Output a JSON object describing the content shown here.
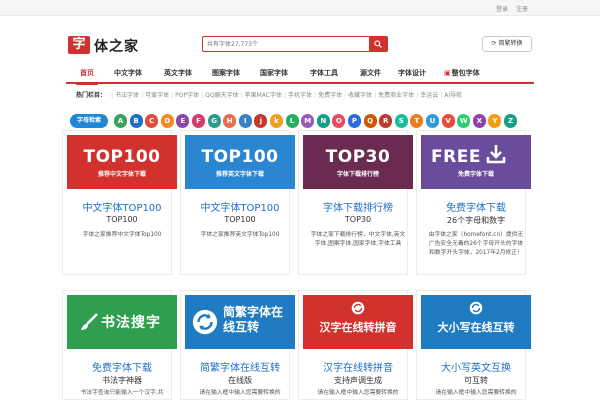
{
  "topbar": {
    "login": "登录",
    "register": "注册"
  },
  "header": {
    "logo_mark": "字",
    "logo_text": "体之家",
    "search_placeholder": "共有字体27,773个",
    "switch_label": "简繁转换"
  },
  "nav": {
    "items": [
      "首页",
      "中文字体",
      "英文字体",
      "图案字体",
      "国家字体",
      "字体工具",
      "源文件",
      "字体设计",
      "整包字体"
    ]
  },
  "hotbar": {
    "label": "热门栏目：",
    "items": [
      "书法字体",
      "可爱字体",
      "POP字体",
      "QQ聊天字体",
      "苹果MAC字体",
      "手机字体",
      "免费字体",
      "收藏字体",
      "免费商业字体",
      "幸运云",
      "AI导航"
    ]
  },
  "alphabet": {
    "label": "字母检索",
    "letters": [
      "A",
      "B",
      "C",
      "D",
      "E",
      "F",
      "G",
      "H",
      "I",
      "J",
      "K",
      "L",
      "M",
      "N",
      "O",
      "P",
      "Q",
      "R",
      "S",
      "T",
      "U",
      "V",
      "W",
      "X",
      "Y",
      "Z"
    ],
    "letter_display": [
      "A",
      "B",
      "C",
      "D",
      "E",
      "F",
      "G",
      "H",
      "I",
      "j",
      "k",
      "L",
      "M",
      "N",
      "O",
      "P",
      "Q",
      "R",
      "S",
      "T",
      "U",
      "V",
      "W",
      "X",
      "Y",
      "Z"
    ],
    "colors": [
      "#3aa55a",
      "#1f6fc6",
      "#e04b3a",
      "#f08a24",
      "#8e44ad",
      "#d63c6b",
      "#2a9d8f",
      "#e76f51",
      "#3d7fc4",
      "#c0392b",
      "#f0a020",
      "#27ae60",
      "#9b59b6",
      "#16a085",
      "#e84a5f",
      "#2d6cdf",
      "#d35400",
      "#c0392b",
      "#1abc9c",
      "#e67e22",
      "#3498db",
      "#e74c3c",
      "#2ecc71",
      "#8e44ad",
      "#f39c12",
      "#16a085"
    ]
  },
  "cards_row1": [
    {
      "banner_title": "TOP100",
      "banner_sub": "推荐中文字体下载",
      "title": "中文字体TOP100",
      "sub": "TOP100",
      "desc": "字体之家推荐中文字体Top100",
      "color": "#d1322d"
    },
    {
      "banner_title": "TOP100",
      "banner_sub": "推荐英文字体下载",
      "title": "中文字体TOP100",
      "sub": "TOP100",
      "desc": "字体之家推荐英文字体Top100",
      "color": "#2a86d0"
    },
    {
      "banner_title": "TOP30",
      "banner_sub": "字体下载排行榜",
      "title": "字体下载排行榜",
      "sub": "TOP30",
      "desc": "字体之家下载排行榜，中文字体,英文字体,图案字体,国家字体,字体工具",
      "color": "#6b2a4f"
    },
    {
      "banner_title": "FREE",
      "banner_sub": "免费字体下载",
      "title": "免费字体下载",
      "sub": "26个字母和数字",
      "desc": "由字体之家（homefont.cn）提供无广告安全无毒的26个字母开头的字体和数字开头字体，2017年2月修正！",
      "color": "#6a4c9c"
    }
  ],
  "cards_row2": [
    {
      "banner_text": "书法搜字",
      "title": "免费字体下载",
      "sub": "书法字神器",
      "desc": "书法字查询只能输入一个汉字,共",
      "color": "#2f9e4f"
    },
    {
      "banner_text": "简繁字体在线互转",
      "title": "简繁字体在线互转",
      "sub": "在线版",
      "desc": "请在输入框中输入您需要转换的",
      "color": "#1f7bc2"
    },
    {
      "banner_text": "汉字在线转拼音",
      "title": "汉字在线转拼音",
      "sub": "支持声调生成",
      "desc": "请在输入框中输入您需要转换的",
      "color": "#d1322d"
    },
    {
      "banner_text": "大小写互转",
      "banner_text_full": "大小写在线互转",
      "title": "大小写英文互换",
      "sub": "可互转",
      "desc": "请在输入框中输入您需要转换的",
      "color": "#1f7bc2"
    }
  ]
}
